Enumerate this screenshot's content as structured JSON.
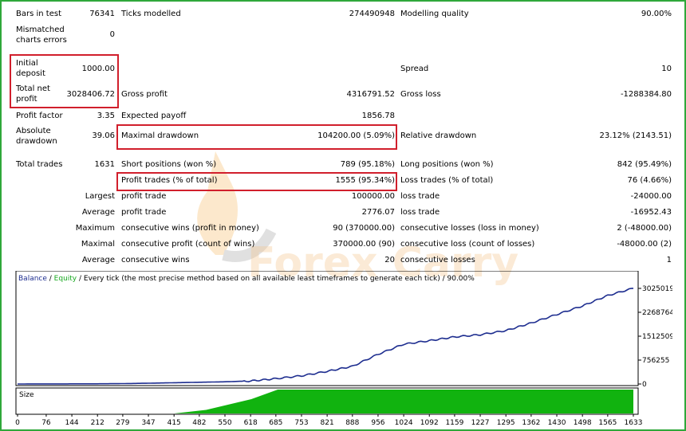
{
  "report": {
    "bars_in_test": {
      "label": "Bars in test",
      "value": "76341"
    },
    "ticks_modelled": {
      "label": "Ticks modelled",
      "value": "274490948"
    },
    "modelling_quality": {
      "label": "Modelling quality",
      "value": "90.00%"
    },
    "mismatched_errors": {
      "label_line1": "Mismatched",
      "label_line2": "charts errors",
      "value": "0"
    },
    "initial_deposit": {
      "label_line1": "Initial",
      "label_line2": "deposit",
      "value": "1000.00"
    },
    "spread": {
      "label": "Spread",
      "value": "10"
    },
    "total_net_profit": {
      "label_line1": "Total net",
      "label_line2": "profit",
      "value": "3028406.72"
    },
    "gross_profit": {
      "label": "Gross profit",
      "value": "4316791.52"
    },
    "gross_loss": {
      "label": "Gross loss",
      "value": "-1288384.80"
    },
    "profit_factor": {
      "label": "Profit factor",
      "value": "3.35"
    },
    "expected_payoff": {
      "label": "Expected payoff",
      "value": "1856.78"
    },
    "absolute_drawdown": {
      "label_line1": "Absolute",
      "label_line2": "drawdown",
      "value": "39.06"
    },
    "maximal_drawdown": {
      "label": "Maximal drawdown",
      "value": "104200.00 (5.09%)"
    },
    "relative_drawdown": {
      "label": "Relative drawdown",
      "value": "23.12% (2143.51)"
    },
    "total_trades": {
      "label": "Total trades",
      "value": "1631"
    },
    "short_positions": {
      "label": "Short positions (won %)",
      "value": "789 (95.18%)"
    },
    "long_positions": {
      "label": "Long positions (won %)",
      "value": "842 (95.49%)"
    },
    "profit_trades": {
      "label": "Profit trades (% of total)",
      "value": "1555 (95.34%)"
    },
    "loss_trades": {
      "label": "Loss trades (% of total)",
      "value": "76 (4.66%)"
    },
    "largest": {
      "label": "Largest",
      "profit_label": "profit trade",
      "profit_value": "100000.00",
      "loss_label": "loss trade",
      "loss_value": "-24000.00"
    },
    "average": {
      "label": "Average",
      "profit_label": "profit trade",
      "profit_value": "2776.07",
      "loss_label": "loss trade",
      "loss_value": "-16952.43"
    },
    "maximum": {
      "label": "Maximum",
      "profit_label": "consecutive wins (profit in money)",
      "profit_value": "90 (370000.00)",
      "loss_label": "consecutive losses (loss in money)",
      "loss_value": "2 (-48000.00)"
    },
    "maximal": {
      "label": "Maximal",
      "profit_label": "consecutive profit (count of wins)",
      "profit_value": "370000.00 (90)",
      "loss_label": "consecutive loss (count of losses)",
      "loss_value": "-48000.00 (2)"
    },
    "average_consecutive": {
      "label": "Average",
      "profit_label": "consecutive wins",
      "profit_value": "20",
      "loss_label": "consecutive losses",
      "loss_value": "1"
    }
  },
  "watermark": "Forex Carry",
  "chart_header": {
    "balance": "Balance",
    "separator": " / ",
    "equity": "Equity",
    "description": " / Every tick (the most precise method based on all available least timeframes to generate each tick) / 90.00%"
  },
  "colors": {
    "balance_line": "#1d2d8f",
    "equity_label": "#17a81f",
    "size_bars": "#11b30f",
    "highlight": "#d11f2c",
    "frame": "#2fa83a"
  },
  "chart_data": {
    "type": "line",
    "series": [
      {
        "name": "Balance",
        "x": [
          0,
          76,
          144,
          212,
          279,
          347,
          415,
          482,
          550,
          618,
          685,
          753,
          821,
          888,
          956,
          1024,
          1092,
          1159,
          1227,
          1295,
          1362,
          1430,
          1498,
          1565,
          1633
        ],
        "values": [
          1000,
          2000,
          4000,
          6000,
          12000,
          25000,
          40000,
          55000,
          70000,
          95000,
          170000,
          260000,
          400000,
          560000,
          940000,
          1260000,
          1370000,
          1490000,
          1560000,
          1690000,
          1930000,
          2200000,
          2470000,
          2800000,
          3028406
        ]
      }
    ],
    "y_ticks": [
      "0",
      "756255",
      "1512509",
      "2268764",
      "3025019"
    ],
    "y_tick_values": [
      0,
      756255,
      1512509,
      2268764,
      3025019
    ],
    "x_ticks": [
      "0",
      "76",
      "144",
      "212",
      "279",
      "347",
      "415",
      "482",
      "550",
      "618",
      "685",
      "753",
      "821",
      "888",
      "956",
      "1024",
      "1092",
      "1159",
      "1227",
      "1295",
      "1362",
      "1430",
      "1498",
      "1565",
      "1633"
    ],
    "xlim": [
      0,
      1633
    ],
    "ylim": [
      0,
      3025019
    ],
    "size_label": "Size",
    "size_series": {
      "x": [
        0,
        415,
        500,
        620,
        690,
        1633
      ],
      "values": [
        0,
        0,
        0.15,
        0.6,
        1,
        1
      ]
    }
  }
}
